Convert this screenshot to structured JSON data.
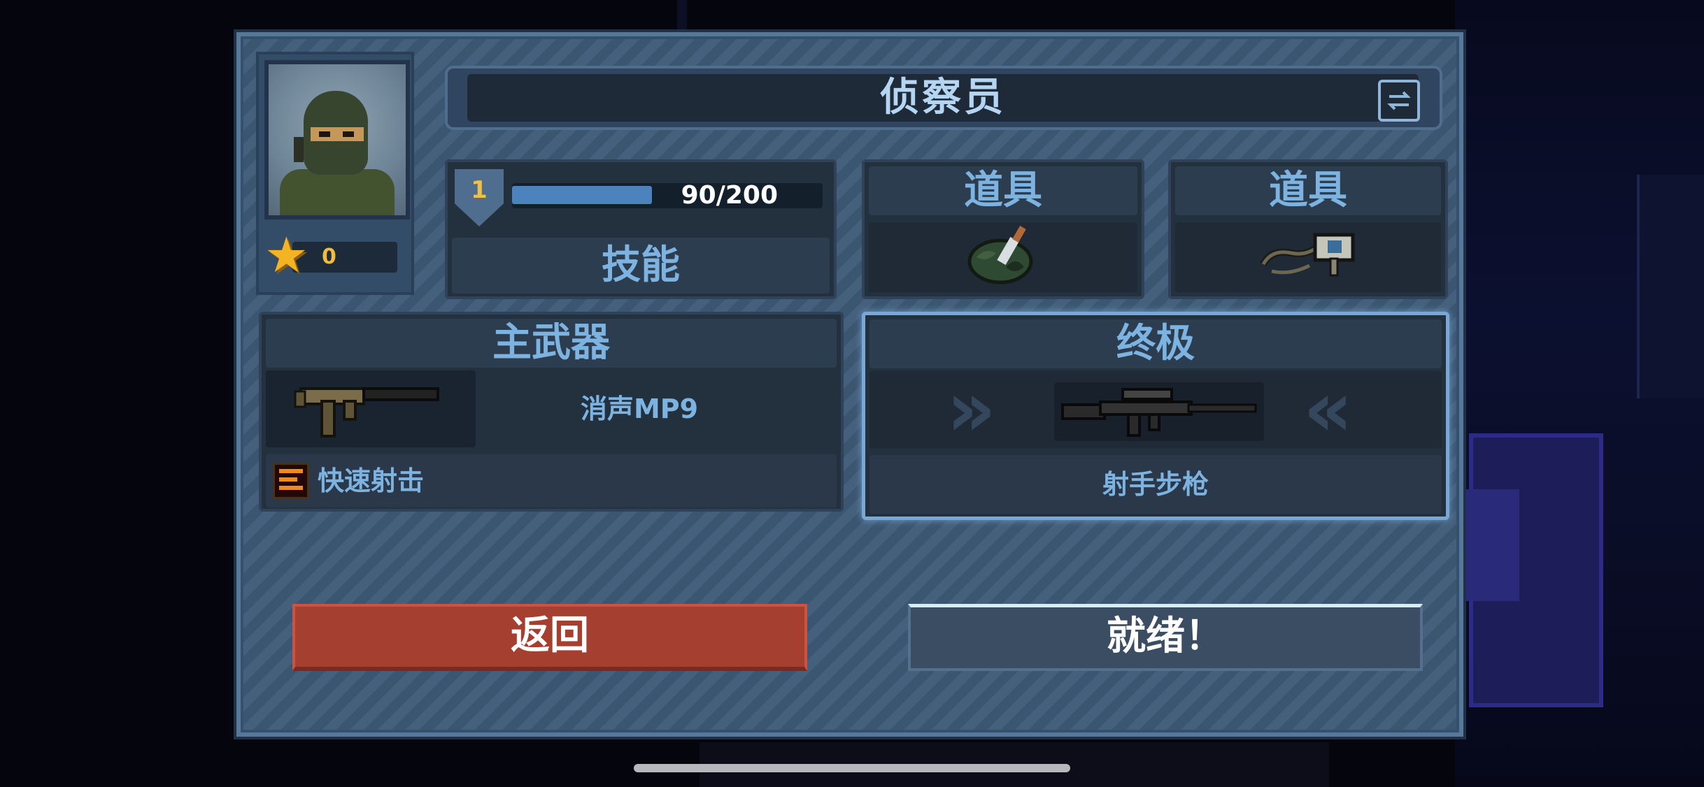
{
  "character": {
    "name": "侦察员",
    "stars": "0",
    "level": "1",
    "xp_text": "90/200",
    "xp_progress": 0.45
  },
  "skill": {
    "label": "技能"
  },
  "items": [
    {
      "label": "道具",
      "icon": "camo-bag-knife-icon"
    },
    {
      "label": "道具",
      "icon": "handcuffs-key-icon"
    }
  ],
  "primary_weapon": {
    "header": "主武器",
    "name": "消声MP9",
    "icon": "smg-mp9-icon",
    "perk": "快速射击",
    "perk_icon": "fast-fire-icon"
  },
  "ultimate": {
    "header": "终极",
    "name": "射手步枪",
    "icon": "marksman-rifle-icon"
  },
  "buttons": {
    "back": "返回",
    "ready": "就绪！"
  },
  "colors": {
    "panel": "#3e5a77",
    "accent_text": "#7cb3e0",
    "back_button": "#a53f30",
    "ready_button": "#3a4d62",
    "star": "#f4b323",
    "xp_fill": "#4c82bd"
  }
}
